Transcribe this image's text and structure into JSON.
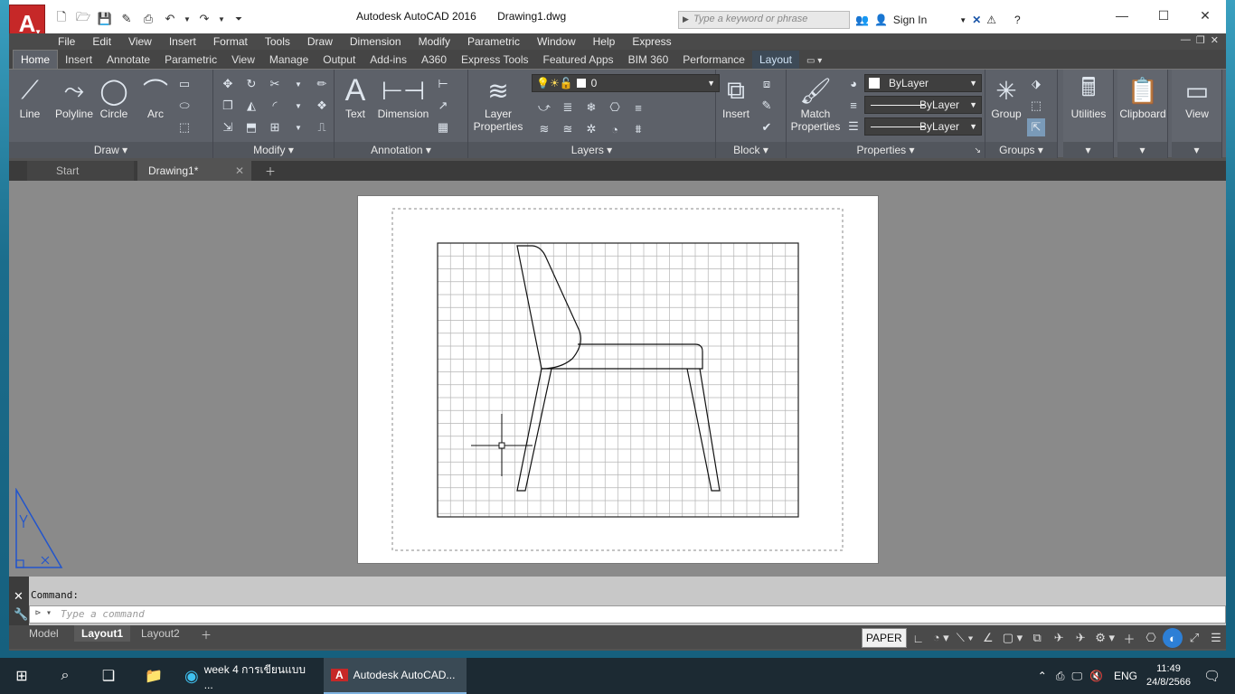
{
  "window": {
    "app_title": "Autodesk AutoCAD 2016",
    "doc_title": "Drawing1.dwg",
    "search_placeholder": "Type a keyword or phrase",
    "signin": "Sign In"
  },
  "menu": [
    "File",
    "Edit",
    "View",
    "Insert",
    "Format",
    "Tools",
    "Draw",
    "Dimension",
    "Modify",
    "Parametric",
    "Window",
    "Help",
    "Express"
  ],
  "ribbon_tabs": [
    "Home",
    "Insert",
    "Annotate",
    "Parametric",
    "View",
    "Manage",
    "Output",
    "Add-ins",
    "A360",
    "Express Tools",
    "Featured Apps",
    "BIM 360",
    "Performance",
    "Layout"
  ],
  "ribbon": {
    "draw": {
      "title": "Draw",
      "line": "Line",
      "polyline": "Polyline",
      "circle": "Circle",
      "arc": "Arc"
    },
    "modify": {
      "title": "Modify"
    },
    "annotation": {
      "title": "Annotation",
      "text": "Text",
      "dimension": "Dimension"
    },
    "layers": {
      "title": "Layers",
      "layer_properties_1": "Layer",
      "layer_properties_2": "Properties",
      "current_layer": "0"
    },
    "block": {
      "title": "Block",
      "insert": "Insert"
    },
    "properties": {
      "title": "Properties",
      "match_1": "Match",
      "match_2": "Properties",
      "color": "ByLayer",
      "linetype": "ByLayer",
      "lineweight": "ByLayer"
    },
    "groups": {
      "title": "Groups",
      "group": "Group"
    },
    "utilities": "Utilities",
    "clipboard": "Clipboard",
    "view": "View"
  },
  "file_tabs": {
    "start": "Start",
    "drawing": "Drawing1*"
  },
  "command": {
    "history": "Command:",
    "placeholder": "Type a command"
  },
  "layout_tabs": [
    "Model",
    "Layout1",
    "Layout2"
  ],
  "status": {
    "paper": "PAPER"
  },
  "taskbar": {
    "edge_app": "week 4 การเขียนแบบ ...",
    "autocad_app": "Autodesk AutoCAD...",
    "lang": "ENG",
    "time": "11:49",
    "date": "24/8/2566"
  }
}
